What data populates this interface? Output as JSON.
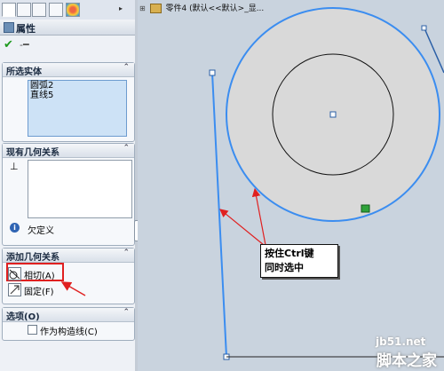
{
  "feature_tree": {
    "part_label": "零件4",
    "config_label": "(默认<<默认>_显..."
  },
  "property_manager": {
    "title": "属性"
  },
  "group_selected": {
    "title": "所选实体",
    "items": [
      "圆弧2",
      "直线5"
    ]
  },
  "group_existing": {
    "title": "现有几何关系",
    "status_text": "欠定义"
  },
  "group_add": {
    "title": "添加几何关系",
    "tangent_label": "相切(A)",
    "fix_label": "固定(F)"
  },
  "group_options": {
    "title": "选项(O)",
    "construction_label": "作为构造线(C)",
    "construction_checked": false
  },
  "callout": {
    "line1": "按住Ctrl键",
    "line2": "同时选中"
  },
  "watermark": {
    "site": "jb51.net",
    "name": "脚本之家"
  },
  "colors": {
    "sketch_blue": "#3b8df0",
    "arrow_red": "#e02020",
    "face_gray": "#d9d9d9",
    "panel_bg": "#eef1f6",
    "selection_bg": "#cde2f6"
  }
}
